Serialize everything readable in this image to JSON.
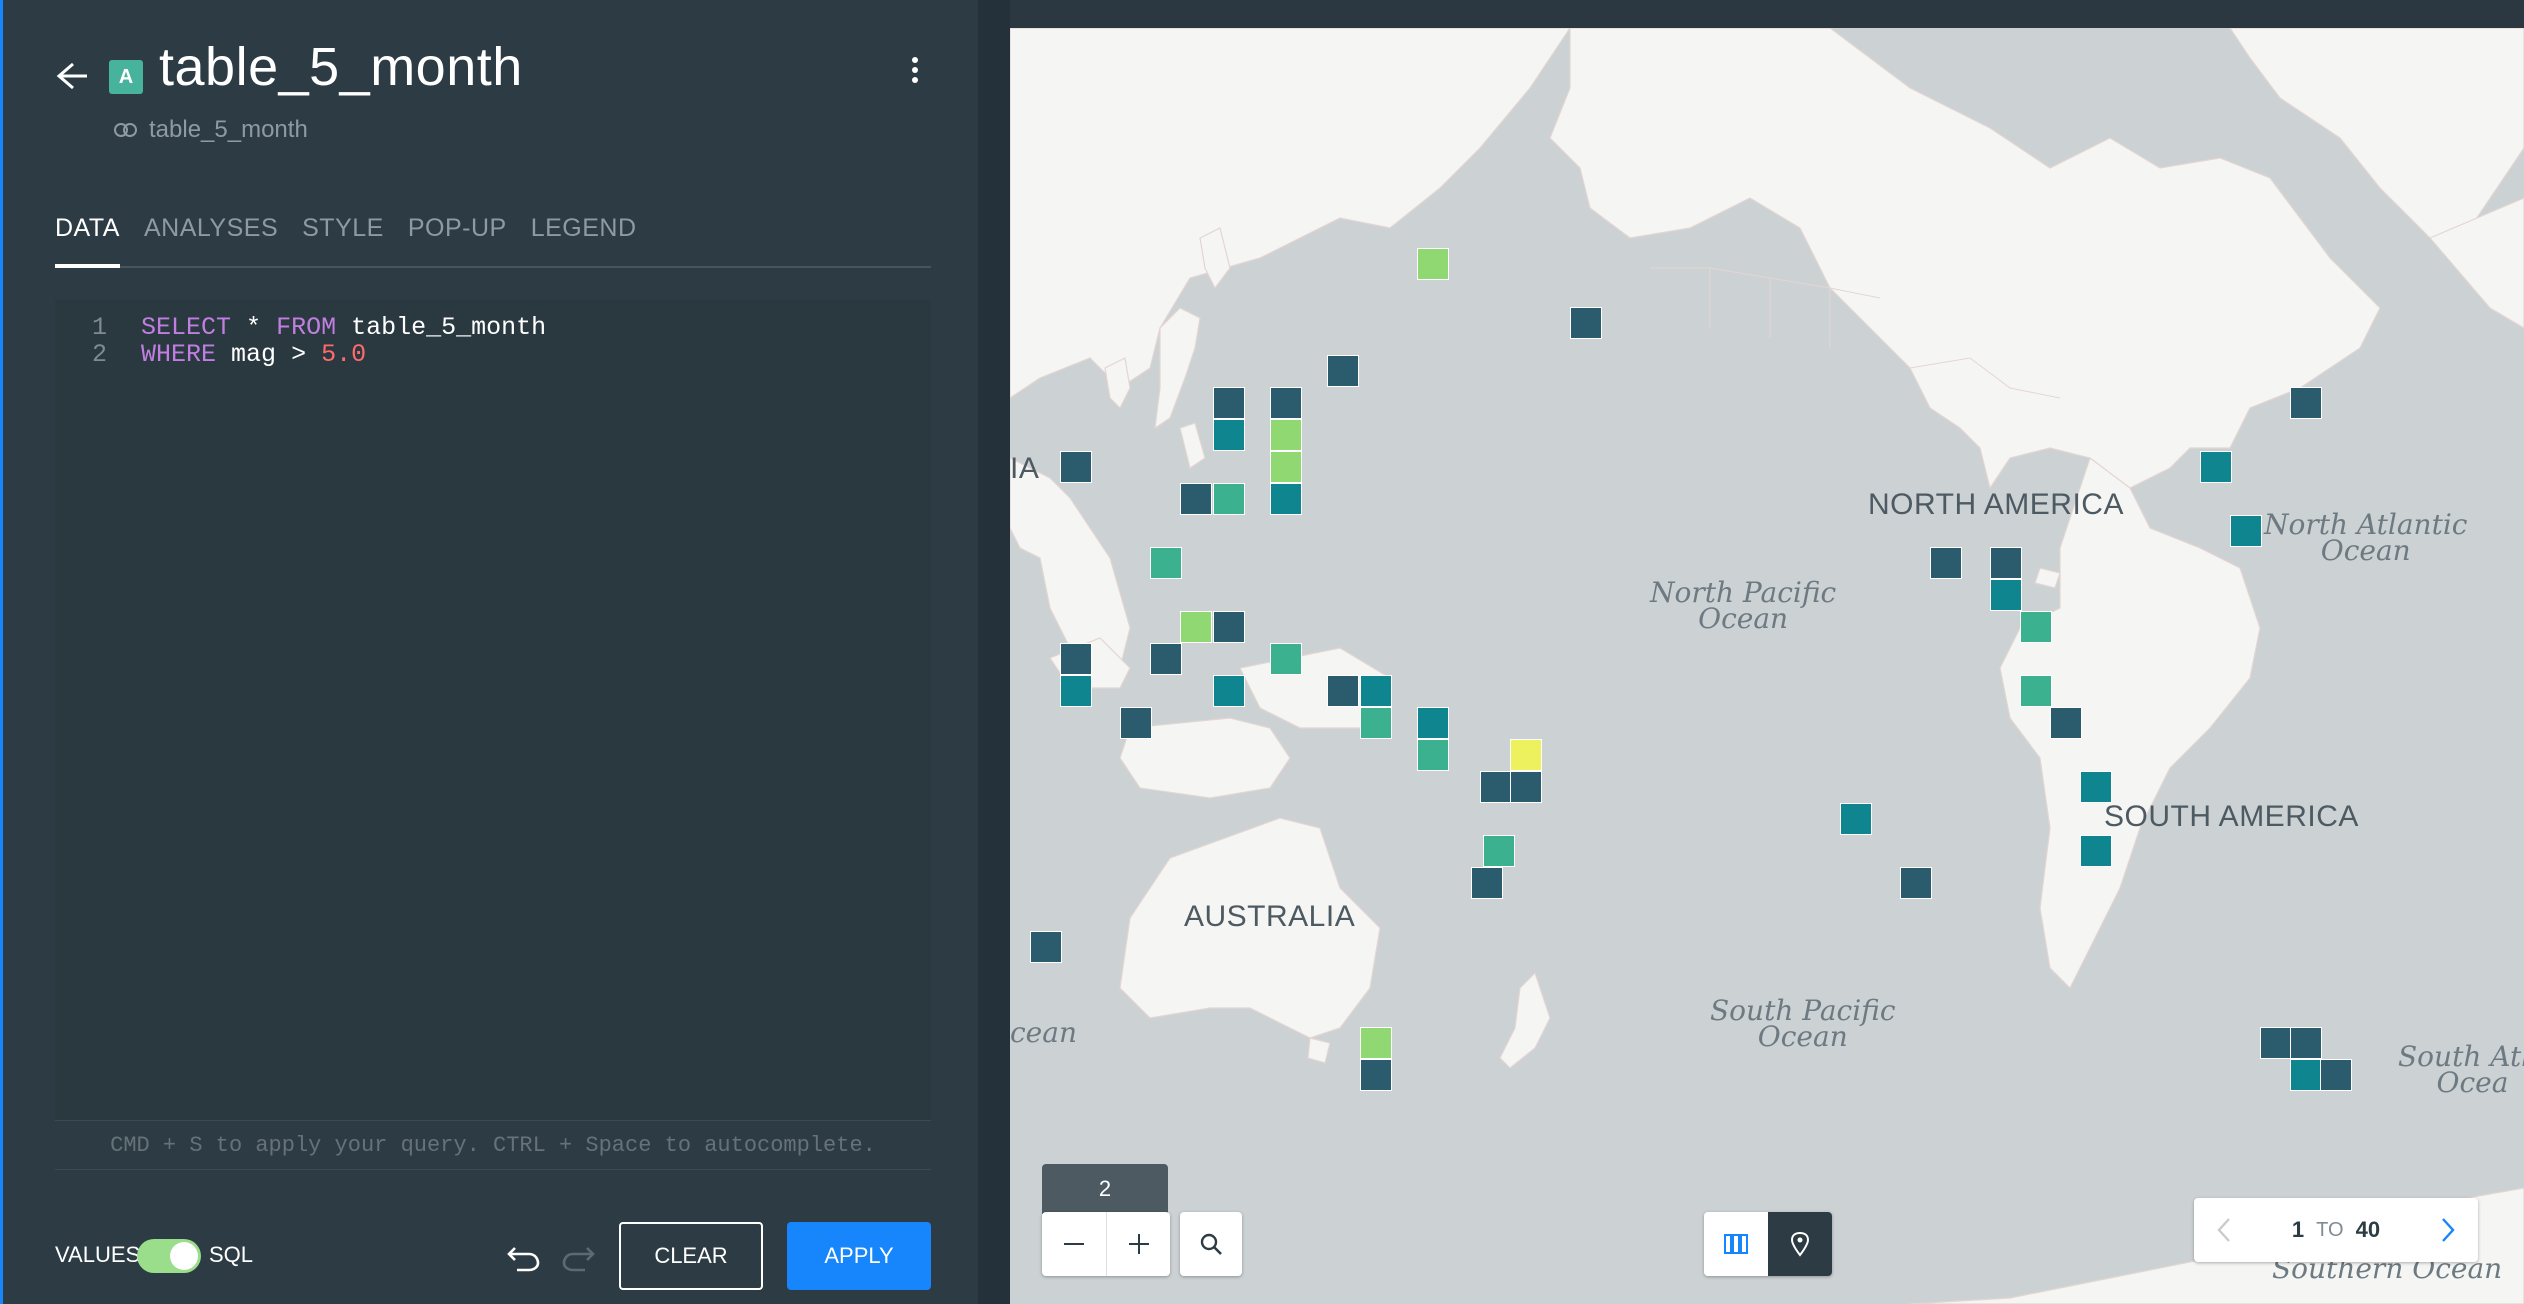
{
  "header": {
    "layer_letter": "A",
    "layer_color": "#47b39c",
    "title": "table_5_month",
    "source_name": "table_5_month"
  },
  "tabs": [
    {
      "label": "DATA",
      "active": true
    },
    {
      "label": "ANALYSES",
      "active": false
    },
    {
      "label": "STYLE",
      "active": false
    },
    {
      "label": "POP-UP",
      "active": false
    },
    {
      "label": "LEGEND",
      "active": false
    }
  ],
  "editor": {
    "lines": [
      {
        "number": "1",
        "text": "SELECT * FROM table_5_month"
      },
      {
        "number": "2",
        "text": "WHERE mag > 5.0"
      }
    ],
    "hint": "CMD + S to apply your query. CTRL + Space to autocomplete."
  },
  "footer": {
    "values_label": "VALUES",
    "sql_label": "SQL",
    "toggle_on": true,
    "clear_label": "CLEAR",
    "apply_label": "APPLY"
  },
  "map": {
    "zoom_level": "2",
    "continent_labels": [
      "NORTH AMERICA",
      "SOUTH AMERICA",
      "AUSTRALIA",
      "IA"
    ],
    "ocean_labels": [
      "North Pacific\nOcean",
      "South Pacific\nOcean",
      "North Atlantic\nOcean",
      "South Atla\nOcea",
      "cean",
      "Southern Ocean"
    ],
    "palette": {
      "dark": "#2a5c6e",
      "teal": "#0f868f",
      "green": "#3bb18f",
      "lime": "#8fd872",
      "yellow": "#eef15e"
    }
  },
  "pager": {
    "from": "1",
    "to_label": "TO",
    "to": "40"
  },
  "icons": [
    "back-arrow-icon",
    "more-vertical-icon",
    "source-node-icon",
    "undo-icon",
    "redo-icon",
    "zoom-out-icon",
    "zoom-in-icon",
    "search-icon",
    "table-view-icon",
    "map-pin-icon",
    "chevron-left-icon",
    "chevron-right-icon"
  ]
}
